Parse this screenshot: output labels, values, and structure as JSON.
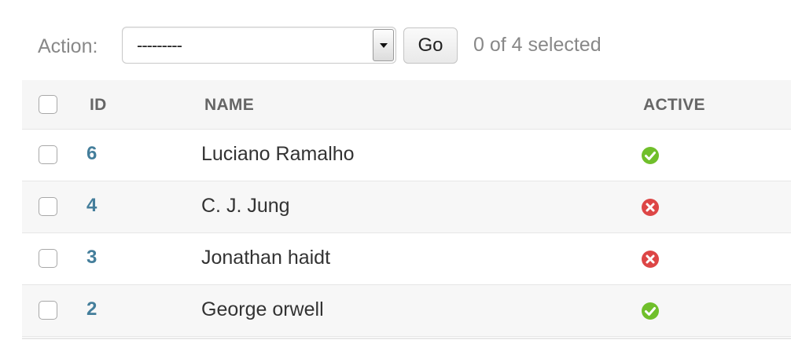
{
  "actions": {
    "label": "Action:",
    "select_value": "---------",
    "go_label": "Go",
    "selected_text": "0 of 4 selected"
  },
  "table": {
    "headers": {
      "id": "ID",
      "name": "NAME",
      "active": "ACTIVE"
    },
    "rows": [
      {
        "id": "6",
        "name": "Luciano Ramalho",
        "active": true,
        "icon": "yes-icon"
      },
      {
        "id": "4",
        "name": "C. J. Jung",
        "active": false,
        "icon": "no-icon"
      },
      {
        "id": "3",
        "name": "Jonathan haidt",
        "active": false,
        "icon": "no-icon"
      },
      {
        "id": "2",
        "name": "George orwell",
        "active": true,
        "icon": "yes-icon"
      }
    ]
  },
  "colors": {
    "link": "#447e9b",
    "active_yes": "#70bf2b",
    "active_no": "#dd4646"
  }
}
